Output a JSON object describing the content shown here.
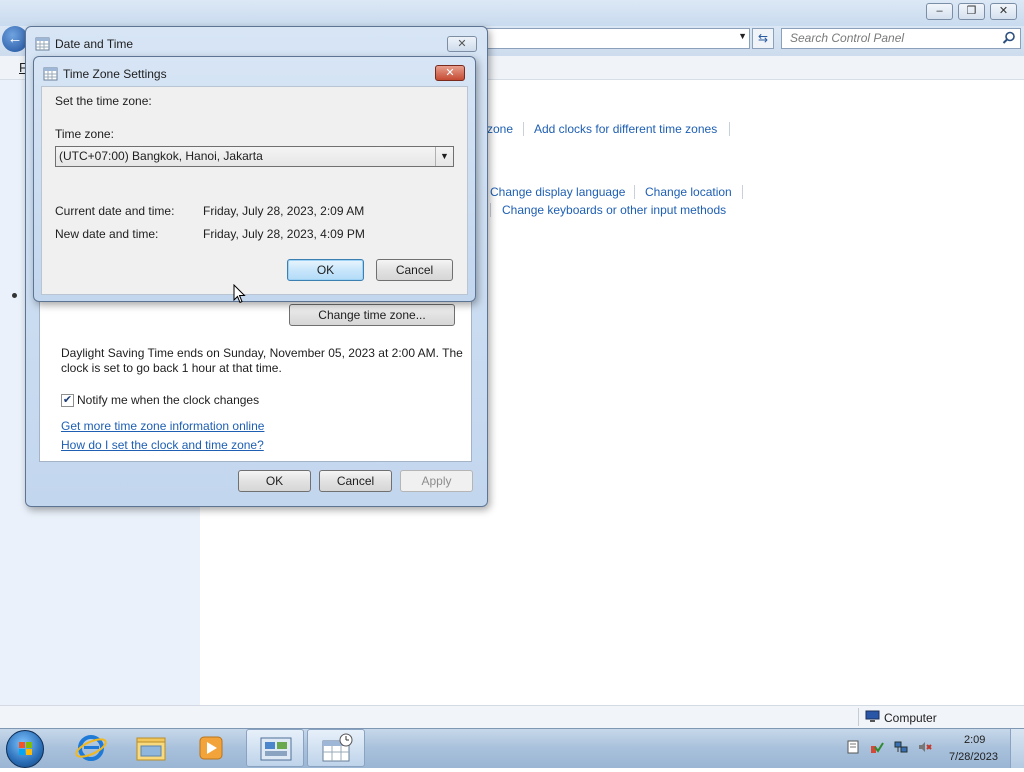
{
  "control_panel": {
    "search_placeholder": "Search Control Panel",
    "menu_first_letter": "F",
    "links": {
      "zone_partial": "zone",
      "add_clocks": "Add clocks for different time zones",
      "change_display_language": "Change display language",
      "change_location": "Change location",
      "change_keyboards": "Change keyboards or other input methods"
    },
    "status_computer": "Computer"
  },
  "date_time_dialog": {
    "title": "Date and Time",
    "change_time_zone_button": "Change time zone...",
    "dst_text_line1": "Daylight Saving Time ends on Sunday, November 05, 2023 at 2:00 AM. The",
    "dst_text_line2": "clock is set to go back 1 hour at that time.",
    "notify_checkbox_label": "Notify me when the clock changes",
    "notify_checked": true,
    "link_more_info": "Get more time zone information online",
    "link_how_to": "How do I set the clock and time zone?",
    "ok": "OK",
    "cancel": "Cancel",
    "apply": "Apply"
  },
  "tz_dialog": {
    "title": "Time Zone Settings",
    "set_label": "Set the time zone:",
    "tz_label": "Time zone:",
    "tz_value": "(UTC+07:00) Bangkok, Hanoi, Jakarta",
    "current_label": "Current date and time:",
    "current_value": "Friday, July 28, 2023, 2:09 AM",
    "new_label": "New date and time:",
    "new_value": "Friday, July 28, 2023, 4:09 PM",
    "ok": "OK",
    "cancel": "Cancel"
  },
  "taskbar": {
    "time": "2:09",
    "date": "7/28/2023"
  }
}
